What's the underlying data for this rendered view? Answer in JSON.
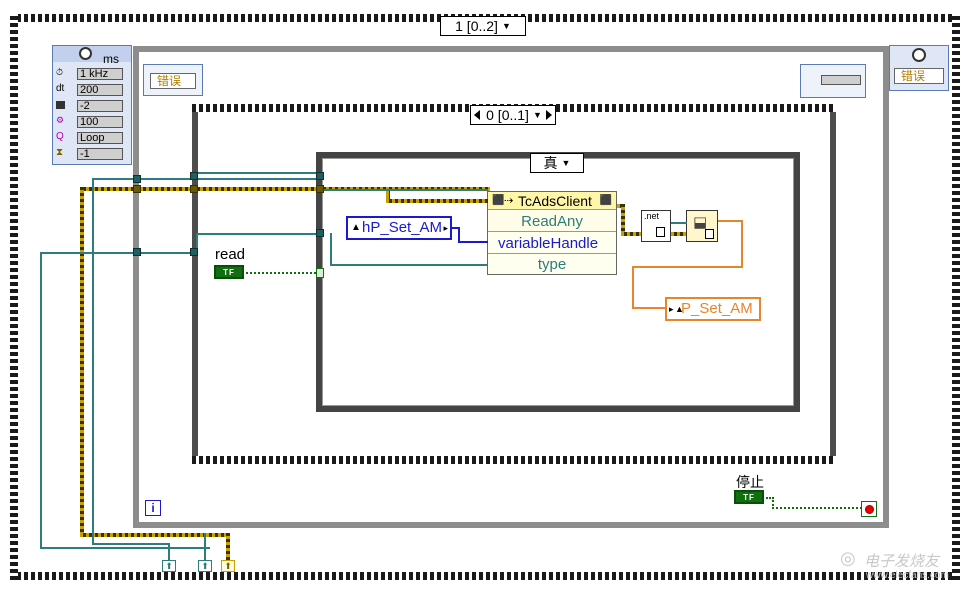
{
  "outer_sequence": {
    "selector_label": "1 [0..2]"
  },
  "inner_case": {
    "selector_label": "0 [0..1]"
  },
  "true_case": {
    "selector_label": "真"
  },
  "timing_node": {
    "title": "ms",
    "rows": [
      {
        "icon": "clock-icon",
        "value": "1 kHz"
      },
      {
        "icon": "dt-label",
        "label": "dt",
        "value": "200"
      },
      {
        "icon": "chip-icon",
        "value": "-2"
      },
      {
        "icon": "offset-icon",
        "value": "100"
      },
      {
        "icon": "name-icon",
        "value": "Loop"
      },
      {
        "icon": "hourglass-icon",
        "value": "-1"
      }
    ]
  },
  "error_in_left": {
    "label": "错误"
  },
  "error_out_right": {
    "label": "错误"
  },
  "read_control": {
    "label": "read",
    "value": "TF"
  },
  "stop_control": {
    "label": "停止",
    "value": "TF"
  },
  "ads_node": {
    "class_name": "TcAdsClient",
    "method": "ReadAny",
    "params": [
      "variableHandle",
      "type"
    ]
  },
  "handle_const": {
    "label": "hP_Set_AM"
  },
  "indicator": {
    "label": "P_Set_AM"
  },
  "net_node": {
    "label": ".net"
  },
  "loop_iteration": {
    "label": "i"
  },
  "watermark": {
    "text": "电子发烧友",
    "url": "www.elecfans.com"
  },
  "colors": {
    "teal": "#2e7d7d",
    "blue": "#1a1acc",
    "orange": "#e8852a",
    "gold": "#c8a000",
    "green": "#107010"
  }
}
